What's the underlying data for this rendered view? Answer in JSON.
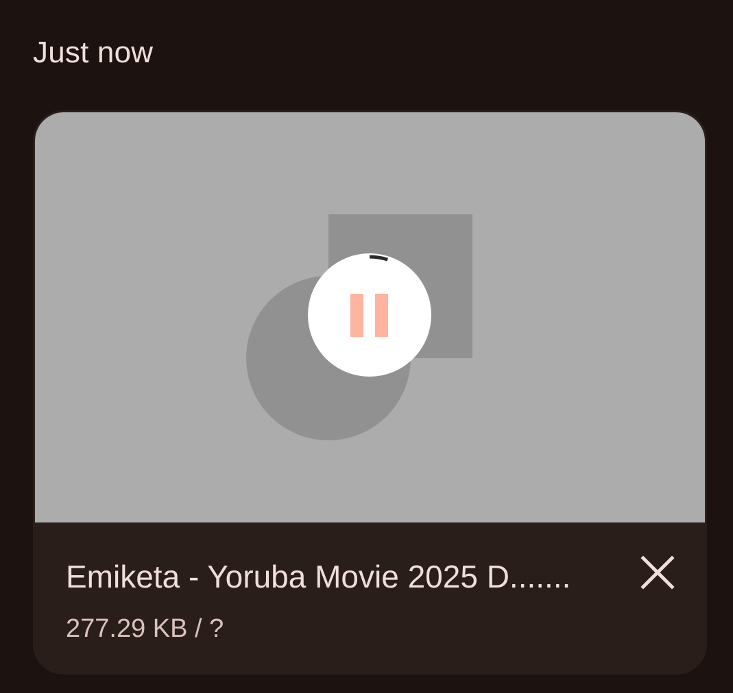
{
  "section": {
    "header": "Just now"
  },
  "download": {
    "title": "Emiketa - Yoruba Movie 2025 D.......",
    "size_text": "277.29 KB / ?",
    "progress_fraction": 0.05,
    "state_icon": "pause-icon",
    "dismiss_icon": "close-icon"
  },
  "colors": {
    "background": "#1c1210",
    "card": "#2a1e1b",
    "thumbnail": "#acacac",
    "placeholder_shapes": "#919191",
    "pause_accent": "#ffb4a0",
    "text_primary": "#f0dedb",
    "text_secondary": "#d9c2bd"
  }
}
